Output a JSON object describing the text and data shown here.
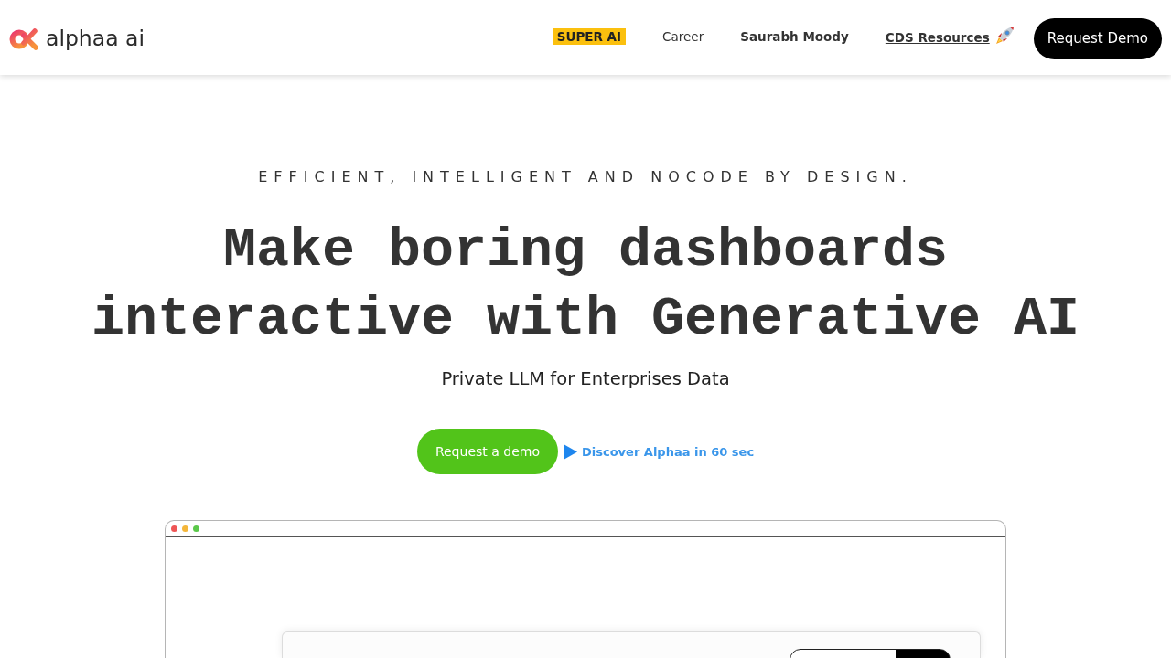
{
  "header": {
    "logo_text": "alphaa ai",
    "nav": [
      {
        "label": "SUPER AI",
        "kind": "badge"
      },
      {
        "label": "Career",
        "kind": "link"
      },
      {
        "label": "Saurabh Moody",
        "kind": "strong"
      },
      {
        "label": "CDS Resources",
        "kind": "resource"
      }
    ],
    "cta": "Request Demo"
  },
  "hero": {
    "tagline": "EFFICIENT, INTELLIGENT AND NOCODE BY DESIGN.",
    "headline": "Make boring dashboards interactive with Generative AI",
    "subtitle": "Private LLM for Enterprises Data",
    "primary_button": "Request a demo",
    "video_link": "Discover Alphaa in 60 sec"
  },
  "preview": {
    "window_dots": [
      {
        "color": "#ee5555"
      },
      {
        "color": "#f4b63a"
      },
      {
        "color": "#5bc84a"
      }
    ]
  }
}
